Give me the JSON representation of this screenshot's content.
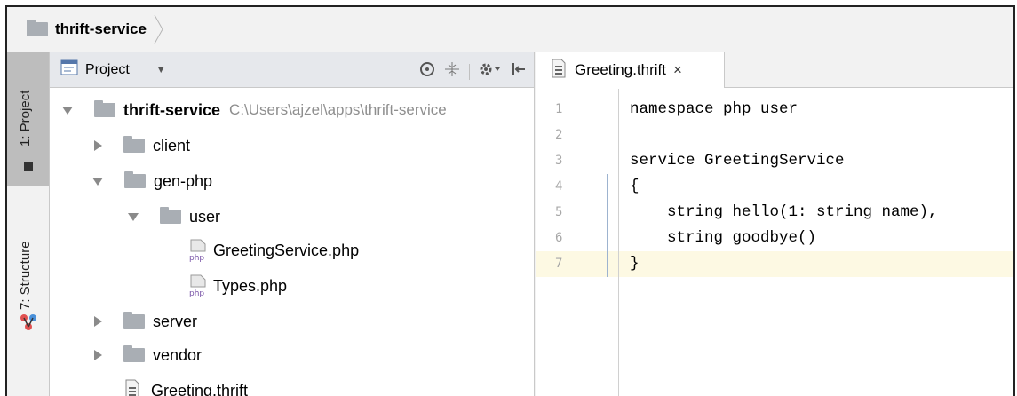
{
  "navbar": {
    "title": "thrift-service",
    "folder_icon": "folder-icon"
  },
  "toolstrip": {
    "project_label": "1: Project",
    "structure_label": "7: Structure"
  },
  "project_panel": {
    "title": "Project",
    "tools": [
      "locate-icon",
      "collapse-icon",
      "gear-icon",
      "hide-icon"
    ]
  },
  "tree": {
    "root": {
      "name": "thrift-service",
      "path": "C:\\Users\\ajzel\\apps\\thrift-service"
    },
    "client": "client",
    "gen_php": "gen-php",
    "user": "user",
    "greeting_service": "GreetingService.php",
    "types": "Types.php",
    "server": "server",
    "vendor": "vendor",
    "greeting_thrift": "Greeting.thrift",
    "php_badge": "php"
  },
  "editor": {
    "tab_label": "Greeting.thrift",
    "close_glyph": "×",
    "lines": [
      {
        "num": "1",
        "text": "namespace php user"
      },
      {
        "num": "2",
        "text": ""
      },
      {
        "num": "3",
        "text": "service GreetingService"
      },
      {
        "num": "4",
        "text": "{"
      },
      {
        "num": "5",
        "text": "    string hello(1: string name),"
      },
      {
        "num": "6",
        "text": "    string goodbye()"
      },
      {
        "num": "7",
        "text": "}"
      }
    ]
  },
  "colors": {
    "current_line": "#fdf9e3",
    "selected_tool": "#bdbdbd",
    "folder": "#a9aeb4"
  }
}
